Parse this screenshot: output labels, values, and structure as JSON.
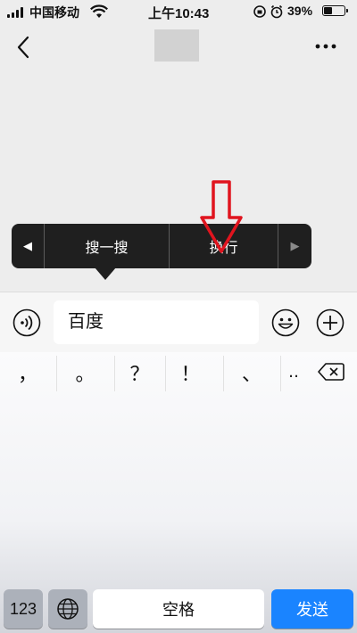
{
  "status_bar": {
    "carrier": "中国移动",
    "time": "上午10:43",
    "battery": "39%"
  },
  "context_menu": {
    "items": [
      {
        "label": "搜一搜"
      },
      {
        "label": "换行"
      }
    ],
    "left_arrow": "◀",
    "right_arrow": "▶"
  },
  "input_bar": {
    "message_text": "百度"
  },
  "keyboard": {
    "punctuation": [
      "，",
      "。",
      "？",
      "！",
      "、",
      "‥"
    ],
    "key_123": "123",
    "space_label": "空格",
    "send_label": "发送"
  },
  "colors": {
    "send_button": "#1a84ff",
    "annotation_arrow": "#e0141e",
    "menu_background": "#1f1f1f"
  }
}
